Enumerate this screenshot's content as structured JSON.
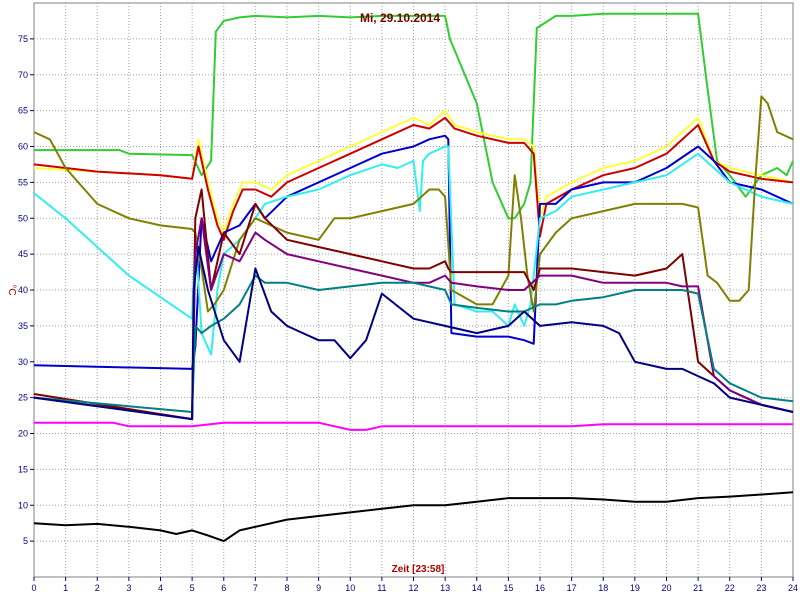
{
  "chart_data": {
    "type": "line",
    "title": "Mi, 29.10.2014",
    "xlabel": "Zeit [23:58]",
    "ylabel": "°C",
    "xlim": [
      0,
      24
    ],
    "ylim": [
      0,
      80
    ],
    "xticks": [
      "0",
      "1",
      "2",
      "3",
      "4",
      "5",
      "6",
      "7",
      "8",
      "9",
      "10",
      "11",
      "12",
      "13",
      "14",
      "15",
      "16",
      "17",
      "18",
      "19",
      "20",
      "21",
      "22",
      "23",
      "24"
    ],
    "yticks": [
      "5",
      "10",
      "15",
      "20",
      "25",
      "30",
      "35",
      "40",
      "45",
      "50",
      "55",
      "60",
      "65",
      "70",
      "75"
    ],
    "grid": true,
    "series": [
      {
        "color": "#33cc33",
        "x": [
          0,
          2.7,
          3,
          5,
          5.3,
          5.6,
          5.75,
          6,
          6.5,
          7,
          8,
          9,
          10,
          11,
          12,
          13,
          13.15,
          14,
          14.5,
          15,
          15.2,
          15.5,
          15.7,
          15.9,
          16.5,
          17,
          18,
          19,
          20,
          21,
          21.3,
          21.6,
          22,
          22.5,
          23,
          23.5,
          23.8,
          24
        ],
        "y": [
          59.5,
          59.5,
          59,
          58.8,
          56,
          58,
          76,
          77.5,
          78,
          78.2,
          78,
          78.2,
          78,
          78.2,
          78.2,
          78.2,
          75,
          66,
          55,
          50,
          50,
          52,
          55,
          76.5,
          78.2,
          78.2,
          78.5,
          78.5,
          78.5,
          78.5,
          68,
          58,
          56,
          53,
          56,
          57,
          56,
          58
        ]
      },
      {
        "color": "#ffff33",
        "x": [
          0,
          2,
          4,
          5,
          5.2,
          5.5,
          5.8,
          6,
          6.3,
          6.6,
          7,
          7.5,
          8,
          9,
          10,
          11,
          12,
          12.5,
          13,
          13.3,
          14,
          15,
          15.5,
          15.8,
          16,
          16.2,
          17,
          18,
          19,
          20,
          21,
          21.5,
          22,
          23,
          24
        ],
        "y": [
          57,
          56.5,
          56,
          55.5,
          61,
          55,
          50,
          48,
          52,
          55,
          55,
          54,
          56,
          58,
          60,
          62,
          64,
          63,
          65,
          63,
          62,
          61,
          61,
          60,
          50,
          53,
          55,
          57,
          58,
          60,
          64,
          58,
          57,
          56,
          55
        ]
      },
      {
        "color": "#cc0000",
        "x": [
          0,
          2,
          4,
          5,
          5.2,
          5.5,
          5.8,
          6,
          6.3,
          6.6,
          7,
          7.5,
          8,
          9,
          10,
          11,
          12,
          12.5,
          13,
          13.3,
          14,
          15,
          15.5,
          15.8,
          16,
          16.2,
          17,
          18,
          19,
          20,
          21,
          21.5,
          22,
          23,
          24
        ],
        "y": [
          57.5,
          56.5,
          56,
          55.5,
          60,
          54,
          49,
          47,
          51,
          54,
          54,
          53,
          55,
          57,
          59,
          61,
          63,
          62.5,
          64,
          62.5,
          61.5,
          60.5,
          60.5,
          59,
          47.5,
          52,
          54,
          56,
          57,
          59,
          63,
          58,
          56.5,
          55.5,
          55
        ]
      },
      {
        "color": "#0000cc",
        "x": [
          0,
          5,
          5.1,
          5.3,
          5.6,
          6,
          6.5,
          7,
          7.3,
          8,
          9,
          10,
          11,
          12,
          12.5,
          13,
          13.1,
          13.2,
          14,
          15,
          15.5,
          15.8,
          16,
          16.5,
          17,
          18,
          19,
          20,
          21,
          21.5,
          22,
          23,
          24
        ],
        "y": [
          29.5,
          29,
          32,
          50,
          44,
          48,
          49,
          52,
          50,
          53,
          55,
          57,
          59,
          60,
          61,
          61.5,
          61,
          34,
          33.5,
          33.5,
          33,
          32.5,
          52,
          52,
          54,
          55,
          55,
          57,
          60,
          58,
          55,
          54,
          52
        ]
      },
      {
        "color": "#33eeee",
        "x": [
          0,
          1,
          2,
          3,
          4,
          5,
          5.1,
          5.3,
          5.6,
          5.8,
          6,
          6.5,
          7,
          7.3,
          8,
          9,
          10,
          11,
          11.5,
          12,
          12.2,
          12.3,
          12.5,
          13,
          13.1,
          13.3,
          14,
          14.5,
          15,
          15.2,
          15.5,
          15.7,
          16,
          16.5,
          17,
          18,
          19,
          20,
          21,
          21.5,
          22,
          23,
          24
        ],
        "y": [
          53.5,
          50,
          46,
          42,
          39,
          36,
          48,
          34,
          31,
          40,
          45,
          47,
          50,
          52,
          53,
          54,
          56,
          57.5,
          57,
          58,
          51,
          58,
          59,
          60,
          60,
          38,
          37,
          37,
          35,
          38,
          35,
          38,
          50,
          51,
          53,
          54,
          55,
          56,
          59,
          57,
          55,
          53,
          52
        ]
      },
      {
        "color": "#808000",
        "x": [
          0,
          0.5,
          1,
          2,
          3,
          4,
          5,
          5.1,
          5.3,
          5.5,
          5.7,
          6,
          6.5,
          7,
          8,
          9,
          9.5,
          10,
          11,
          12,
          12.5,
          12.8,
          13,
          13.2,
          14,
          14.5,
          15,
          15.2,
          15.4,
          15.6,
          15.8,
          16,
          16.5,
          17,
          18,
          19,
          20,
          20.5,
          21,
          21.3,
          21.6,
          22,
          22.3,
          22.6,
          22.8,
          23,
          23.2,
          23.5,
          24
        ],
        "y": [
          62,
          61,
          57,
          52,
          50,
          49,
          48.5,
          48,
          43,
          37,
          38,
          40,
          47,
          50,
          48,
          47,
          50,
          50,
          51,
          52,
          54,
          54,
          53,
          40,
          38,
          38,
          42,
          56,
          50,
          42,
          37,
          45,
          48,
          50,
          51,
          52,
          52,
          52,
          51.5,
          42,
          41,
          38.5,
          38.5,
          40,
          55,
          67,
          66,
          62,
          61
        ]
      },
      {
        "color": "#800000",
        "x": [
          0,
          5,
          5.1,
          5.3,
          5.6,
          6,
          6.5,
          7,
          7.3,
          8,
          9,
          10,
          11,
          12,
          12.5,
          13,
          13.1,
          13.2,
          14,
          15,
          15.5,
          15.8,
          16,
          16.5,
          17,
          18,
          19,
          20,
          20.5,
          21,
          21.5,
          22,
          23,
          24
        ],
        "y": [
          25.5,
          22,
          50,
          54,
          40,
          48,
          45,
          52,
          50,
          47,
          46,
          45,
          44,
          43,
          43,
          44,
          43,
          42.5,
          42.5,
          42.5,
          42.5,
          40,
          43,
          43,
          43,
          42.5,
          42,
          43,
          45,
          30,
          28,
          26,
          24,
          23
        ]
      },
      {
        "color": "#800080",
        "x": [
          0,
          5,
          5.1,
          5.3,
          5.6,
          6,
          6.5,
          7,
          7.3,
          8,
          9,
          10,
          11,
          12,
          12.5,
          13,
          13.2,
          14,
          15,
          15.5,
          16,
          16.5,
          17,
          18,
          19,
          20,
          20.5,
          21,
          21.5,
          22,
          23,
          24
        ],
        "y": [
          25,
          22,
          45,
          50,
          40,
          45,
          44,
          48,
          47,
          45,
          44,
          43,
          42,
          41,
          41,
          42,
          41,
          40.5,
          40,
          40,
          42,
          42,
          42,
          41,
          41,
          41,
          40.5,
          40.5,
          28,
          26,
          24,
          23
        ]
      },
      {
        "color": "#008080",
        "x": [
          0,
          5,
          5.1,
          5.3,
          5.6,
          6,
          6.5,
          7,
          7.3,
          8,
          9,
          10,
          11,
          12,
          12.5,
          13,
          13.2,
          14,
          15,
          15.5,
          16,
          16.5,
          17,
          18,
          19,
          20,
          20.5,
          21,
          21.5,
          22,
          23,
          24
        ],
        "y": [
          25,
          23,
          35,
          34,
          35,
          36,
          38,
          42,
          41,
          41,
          40,
          40.5,
          41,
          41,
          40.5,
          40,
          38,
          37.5,
          37,
          37,
          38,
          38,
          38.5,
          39,
          40,
          40,
          40,
          39.5,
          29,
          27,
          25,
          24.5
        ]
      },
      {
        "color": "#000080",
        "x": [
          0,
          5,
          5.05,
          5.2,
          5.5,
          6,
          6.5,
          7,
          7.5,
          8,
          8.5,
          9,
          9.5,
          10,
          10.5,
          11,
          12,
          13,
          14,
          15,
          15.5,
          16,
          17,
          18,
          18.5,
          19,
          20,
          20.5,
          21,
          21.5,
          22,
          23,
          24
        ],
        "y": [
          25,
          22,
          40,
          46,
          40,
          33,
          30,
          43,
          37,
          35,
          34,
          33,
          33,
          30.5,
          33,
          39.5,
          36,
          35,
          34,
          35,
          37,
          35,
          35.5,
          35,
          34,
          30,
          29,
          29,
          28,
          27,
          25,
          24,
          23
        ]
      },
      {
        "color": "#ff00ff",
        "x": [
          0,
          2.5,
          3,
          5,
          6,
          9,
          10,
          10.5,
          11,
          16,
          17,
          18,
          21,
          24
        ],
        "y": [
          21.5,
          21.5,
          21,
          21,
          21.5,
          21.5,
          20.5,
          20.5,
          21,
          21,
          21,
          21.3,
          21.3,
          21.3
        ]
      },
      {
        "color": "#000000",
        "x": [
          0,
          1,
          2,
          3,
          4,
          4.5,
          5,
          5.5,
          6,
          6.5,
          7,
          8,
          9,
          10,
          11,
          12,
          13,
          14,
          15,
          16,
          17,
          18,
          19,
          20,
          21,
          22,
          23,
          24
        ],
        "y": [
          7.5,
          7.2,
          7.4,
          7,
          6.5,
          6,
          6.5,
          5.8,
          5,
          6.5,
          7,
          8,
          8.5,
          9,
          9.5,
          10,
          10,
          10.5,
          11,
          11,
          11,
          10.8,
          10.5,
          10.5,
          11,
          11.2,
          11.5,
          11.8
        ]
      }
    ]
  }
}
